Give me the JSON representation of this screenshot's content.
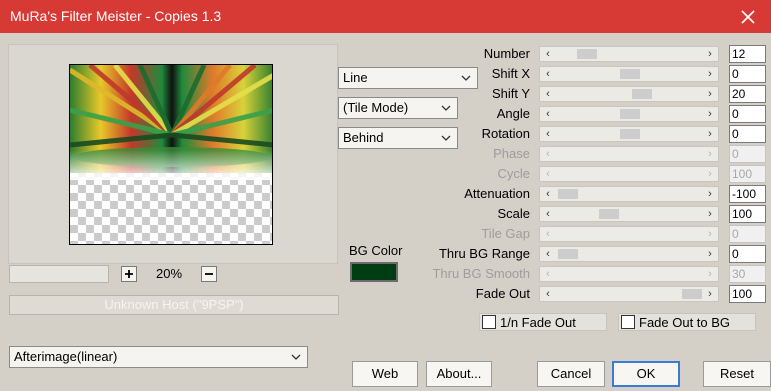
{
  "window": {
    "title": "MuRa's Filter Meister - Copies 1.3"
  },
  "preview": {
    "zoom": "20%",
    "host_text": "Unknown Host (\"9PSP\")"
  },
  "combos": {
    "mode": "Line",
    "tile_mode": "(Tile Mode)",
    "placement": "Behind",
    "effect": "Afterimage(linear)"
  },
  "params": [
    {
      "label": "Number",
      "value": "12",
      "enabled": true,
      "pos": 0.15
    },
    {
      "label": "Shift X",
      "value": "0",
      "enabled": true,
      "pos": 0.5
    },
    {
      "label": "Shift Y",
      "value": "20",
      "enabled": true,
      "pos": 0.6
    },
    {
      "label": "Angle",
      "value": "0",
      "enabled": true,
      "pos": 0.5
    },
    {
      "label": "Rotation",
      "value": "0",
      "enabled": true,
      "pos": 0.5
    },
    {
      "label": "Phase",
      "value": "0",
      "enabled": false,
      "pos": null
    },
    {
      "label": "Cycle",
      "value": "100",
      "enabled": false,
      "pos": null
    },
    {
      "label": "Attenuation",
      "value": "-100",
      "enabled": true,
      "pos": 0.0
    },
    {
      "label": "Scale",
      "value": "100",
      "enabled": true,
      "pos": 0.33
    },
    {
      "label": "Tile Gap",
      "value": "0",
      "enabled": false,
      "pos": null
    },
    {
      "label": "Thru BG Range",
      "value": "0",
      "enabled": true,
      "pos": 0.0
    },
    {
      "label": "Thru BG Smooth",
      "value": "30",
      "enabled": false,
      "pos": null
    },
    {
      "label": "Fade Out",
      "value": "100",
      "enabled": true,
      "pos": 1.0
    }
  ],
  "bg_color": {
    "label": "BG Color",
    "value": "#003d12"
  },
  "checkboxes": {
    "n_fade_out": "1/n Fade Out",
    "fade_out_to_bg": "Fade Out to BG"
  },
  "buttons": {
    "web": "Web",
    "about": "About...",
    "cancel": "Cancel",
    "ok": "OK",
    "reset": "Reset"
  },
  "colors": {
    "titlebar": "#d73a35",
    "dialog": "#d4d0c8",
    "ok_border": "#3a7bd5"
  }
}
